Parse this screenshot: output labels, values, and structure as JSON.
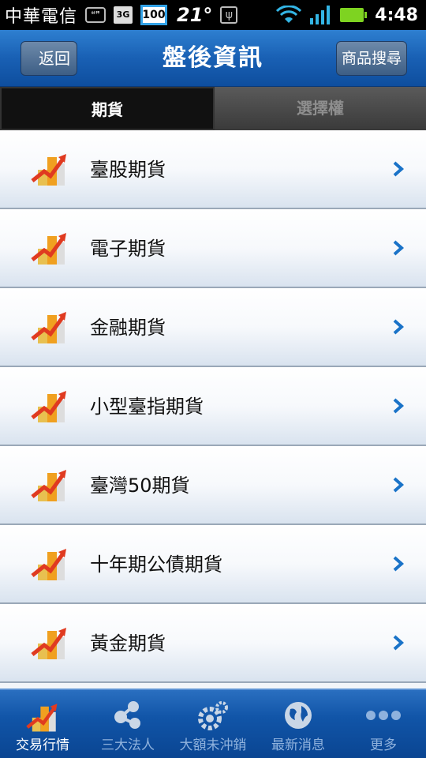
{
  "status_bar": {
    "carrier": "中華電信",
    "network": "3G",
    "notification_badge": "100",
    "temperature": "21°",
    "time": "4:48"
  },
  "header": {
    "back_label": "返回",
    "title": "盤後資訊",
    "search_label": "商品搜尋"
  },
  "tabs": [
    {
      "label": "期貨",
      "active": true
    },
    {
      "label": "選擇權",
      "active": false
    }
  ],
  "list": {
    "items": [
      {
        "label": "臺股期貨"
      },
      {
        "label": "電子期貨"
      },
      {
        "label": "金融期貨"
      },
      {
        "label": "小型臺指期貨"
      },
      {
        "label": "臺灣50期貨"
      },
      {
        "label": "十年期公債期貨"
      },
      {
        "label": "黃金期貨"
      }
    ]
  },
  "bottom_nav": [
    {
      "label": "交易行情",
      "icon": "chart-icon",
      "active": true
    },
    {
      "label": "三大法人",
      "icon": "network-icon",
      "active": false
    },
    {
      "label": "大額未沖銷",
      "icon": "gears-icon",
      "active": false
    },
    {
      "label": "最新消息",
      "icon": "globe-icon",
      "active": false
    },
    {
      "label": "更多",
      "icon": "more-icon",
      "active": false
    }
  ],
  "colors": {
    "header_blue": "#1960b4",
    "chevron_blue": "#1a73c8",
    "active_tab_bg": "#111111"
  }
}
